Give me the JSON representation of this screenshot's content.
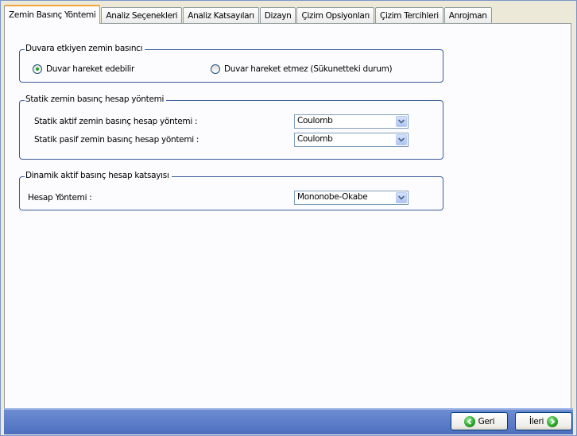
{
  "tabs": [
    {
      "label": "Zemin Basınç Yöntemi",
      "active": true
    },
    {
      "label": "Analiz Seçenekleri",
      "active": false
    },
    {
      "label": "Analiz Katsayıları",
      "active": false
    },
    {
      "label": "Dizayn",
      "active": false
    },
    {
      "label": "Çizim Opsiyonları",
      "active": false
    },
    {
      "label": "Çizim Tercihleri",
      "active": false
    },
    {
      "label": "Anrojman",
      "active": false
    }
  ],
  "group_wall": {
    "title": "Duvara etkiyen zemin basıncı",
    "option_moving": "Duvar hareket edebilir",
    "option_fixed": "Duvar hareket etmez (Sükunetteki durum)",
    "selected": "moving"
  },
  "group_static": {
    "title": "Statik zemin basınç hesap yöntemi",
    "active_label": "Statik aktif zemin basınç hesap yöntemi :",
    "active_value": "Coulomb",
    "passive_label": "Statik pasif zemin basınç hesap yöntemi :",
    "passive_value": "Coulomb"
  },
  "group_dynamic": {
    "title": "Dinamik aktif basınç hesap katsayısı",
    "method_label": "Hesap Yöntemi :",
    "method_value": "Mononobe-Okabe"
  },
  "footer": {
    "back_label": "Geri",
    "next_label": "İleri"
  },
  "colors": {
    "group_border": "#3a5c98",
    "footer_bar": "#5a7bc8",
    "active_tab_accent": "#f2a53c"
  }
}
